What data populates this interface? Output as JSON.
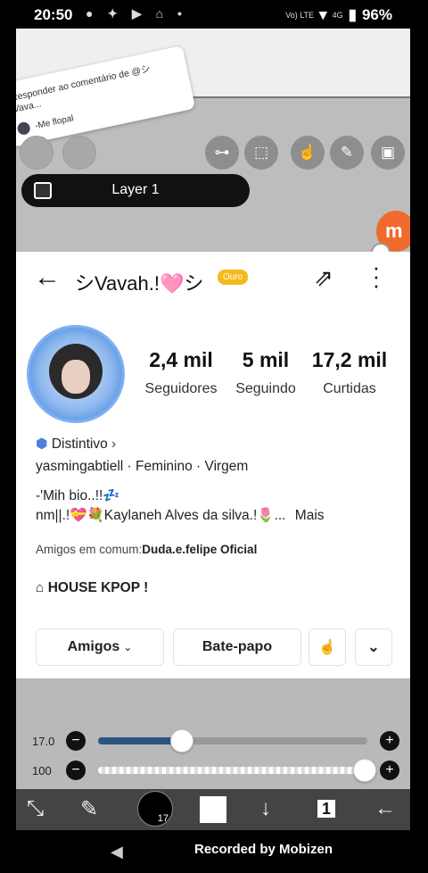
{
  "status_bar": {
    "time": "20:50",
    "notif_icons": "● ✦ ▶ ⌂ •",
    "volte": "Vo) LTE",
    "net": "4G",
    "battery": "96%"
  },
  "comment": {
    "title": "Responder ao comentário de @シVava...",
    "text": "-Me flopal"
  },
  "layer": {
    "label": "Layer 1"
  },
  "app_logo": "m",
  "profile": {
    "username": "シVavah.!🩷シ",
    "badge": "Ouro",
    "stats": [
      {
        "value": "2,4 mil",
        "label": "Seguidores"
      },
      {
        "value": "5 mil",
        "label": "Seguindo"
      },
      {
        "value": "17,2 mil",
        "label": "Curtidas"
      }
    ],
    "distintivo": "Distintivo",
    "info": "yasmingabtiell · Feminino · Virgem",
    "bio_line1": "-'Mih bio..!!💤",
    "bio_line2": "nm||.!💝💐Kaylaneh Alves da silva.!🌷...",
    "more": "Mais",
    "friends_label": "Amigos em comum:",
    "friends_name": "Duda.e.felipe Oficial",
    "house": "HOUSE KPOP !",
    "btn_friends": "Amigos",
    "btn_chat": "Bate-papo"
  },
  "sliders": {
    "size_label": "17.0",
    "size_fraction": 0.31,
    "opacity_label": "100",
    "opacity_fraction": 0.99
  },
  "toolbar": {
    "brush_size": "17",
    "layers_count": "1"
  },
  "navbar": {
    "recorded": "Recorded by Mobizen"
  },
  "colors": {
    "accent_blue": "#2d5380",
    "logo_orange": "#ef6a2c",
    "badge_gold": "#f6b91c"
  }
}
